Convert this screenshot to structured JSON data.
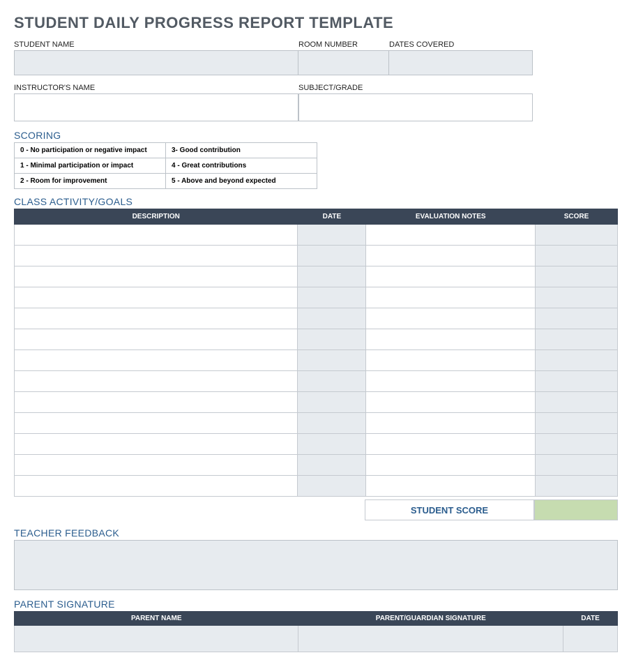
{
  "title": "STUDENT DAILY PROGRESS REPORT TEMPLATE",
  "info_row1": {
    "student_name_label": "STUDENT NAME",
    "room_number_label": "ROOM NUMBER",
    "dates_covered_label": "DATES COVERED"
  },
  "info_row2": {
    "instructor_label": "INSTRUCTOR'S NAME",
    "subject_label": "SUBJECT/GRADE"
  },
  "scoring": {
    "heading": "SCORING",
    "rows": [
      {
        "left": "0 - No participation or negative impact",
        "right": "3- Good contribution"
      },
      {
        "left": "1 - Minimal participation or impact",
        "right": "4 - Great contributions"
      },
      {
        "left": "2 - Room for improvement",
        "right": "5 - Above and beyond expected"
      }
    ]
  },
  "activity": {
    "heading": "CLASS ACTIVITY/GOALS",
    "headers": {
      "description": "DESCRIPTION",
      "date": "DATE",
      "notes": "EVALUATION NOTES",
      "score": "SCORE"
    },
    "row_count": 13,
    "student_score_label": "STUDENT SCORE"
  },
  "feedback": {
    "heading": "TEACHER FEEDBACK"
  },
  "signature": {
    "heading": "PARENT SIGNATURE",
    "headers": {
      "name": "PARENT NAME",
      "sign": "PARENT/GUARDIAN SIGNATURE",
      "date": "DATE"
    }
  }
}
